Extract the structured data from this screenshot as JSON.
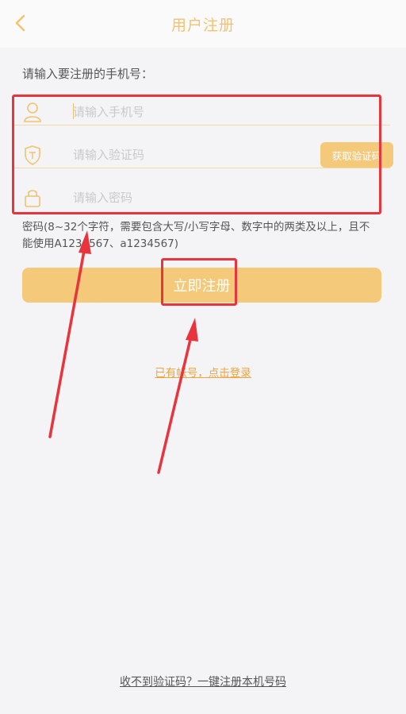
{
  "header": {
    "title": "用户注册",
    "back_icon": "chevron-left-icon"
  },
  "form": {
    "prompt": "请输入要注册的手机号：",
    "phone": {
      "placeholder": "请输入手机号",
      "value": "",
      "icon": "user-icon"
    },
    "code": {
      "placeholder": "请输入验证码",
      "value": "",
      "icon": "shield-icon",
      "button_label": "获取验证码"
    },
    "password": {
      "placeholder": "请输入密码",
      "value": "",
      "icon": "lock-icon"
    },
    "hint": "密码(8~32个字符，需要包含大写/小写字母、数字中的两类及以上，且不能使用A1234567、a1234567)",
    "submit_label": "立即注册"
  },
  "links": {
    "login": "已有帐号，点击登录",
    "one_click": "收不到验证码？一键注册本机号码"
  },
  "colors": {
    "accent": "#f4c97a",
    "title": "#f2c26f",
    "link": "#f0a53c",
    "highlight": "#e8343c"
  }
}
